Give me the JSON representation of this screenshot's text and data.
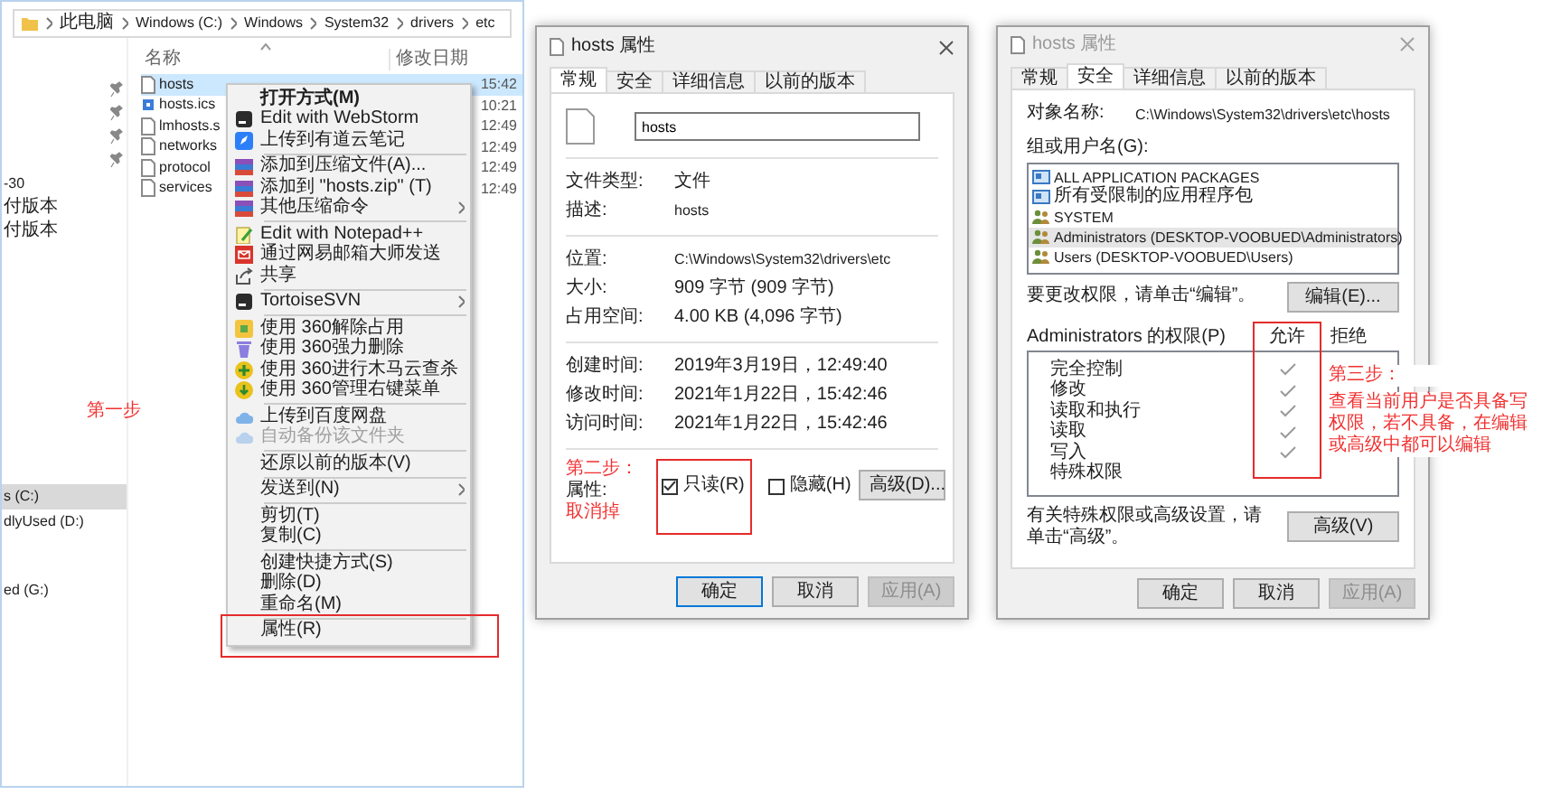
{
  "explorer": {
    "breadcrumb": [
      "此电脑",
      "Windows (C:)",
      "Windows",
      "System32",
      "drivers",
      "etc"
    ],
    "nav_items": [
      {
        "label": "-30",
        "selected": false
      },
      {
        "label": "付版本",
        "selected": false
      },
      {
        "label": "付版本",
        "selected": false
      },
      {
        "label": "s (C:)",
        "selected": true
      },
      {
        "label": "dlyUsed (D:)",
        "selected": false
      },
      {
        "label": "ed (G:)",
        "selected": false
      }
    ],
    "columns": [
      "名称",
      "修改日期"
    ],
    "files": [
      {
        "name": "hosts",
        "modified": "15:42",
        "kind": "document",
        "selected": true
      },
      {
        "name": "hosts.ics",
        "modified": "10:21",
        "kind": "settings",
        "selected": false
      },
      {
        "name": "lmhosts.s",
        "modified": "12:49",
        "kind": "document",
        "selected": false
      },
      {
        "name": "networks",
        "modified": "12:49",
        "kind": "document",
        "selected": false
      },
      {
        "name": "protocol",
        "modified": "12:49",
        "kind": "document",
        "selected": false
      },
      {
        "name": "services",
        "modified": "12:49",
        "kind": "document",
        "selected": false
      }
    ],
    "annotation": "第一步"
  },
  "context_menu": {
    "items": [
      {
        "kind": "item",
        "label": "打开方式(M)",
        "default": true,
        "disabled": false,
        "submenu": false,
        "highlighted": false
      },
      {
        "kind": "item",
        "label": "Edit with WebStorm",
        "default": false,
        "disabled": false,
        "submenu": false,
        "highlighted": false
      },
      {
        "kind": "item",
        "label": "上传到有道云笔记",
        "default": false,
        "disabled": false,
        "submenu": false,
        "highlighted": false
      },
      {
        "kind": "separator"
      },
      {
        "kind": "item",
        "label": "添加到压缩文件(A)...",
        "default": false,
        "disabled": false,
        "submenu": false,
        "highlighted": false
      },
      {
        "kind": "item",
        "label": "添加到 \"hosts.zip\" (T)",
        "default": false,
        "disabled": false,
        "submenu": false,
        "highlighted": false
      },
      {
        "kind": "item",
        "label": "其他压缩命令",
        "default": false,
        "disabled": false,
        "submenu": true,
        "highlighted": false
      },
      {
        "kind": "separator"
      },
      {
        "kind": "item",
        "label": "Edit with Notepad++",
        "default": false,
        "disabled": false,
        "submenu": false,
        "highlighted": false
      },
      {
        "kind": "item",
        "label": "通过网易邮箱大师发送",
        "default": false,
        "disabled": false,
        "submenu": false,
        "highlighted": false
      },
      {
        "kind": "item",
        "label": "共享",
        "default": false,
        "disabled": false,
        "submenu": false,
        "highlighted": false
      },
      {
        "kind": "separator"
      },
      {
        "kind": "item",
        "label": "TortoiseSVN",
        "default": false,
        "disabled": false,
        "submenu": true,
        "highlighted": false
      },
      {
        "kind": "separator"
      },
      {
        "kind": "item",
        "label": "使用 360解除占用",
        "default": false,
        "disabled": false,
        "submenu": false,
        "highlighted": false
      },
      {
        "kind": "item",
        "label": "使用 360强力删除",
        "default": false,
        "disabled": false,
        "submenu": false,
        "highlighted": false
      },
      {
        "kind": "item",
        "label": "使用 360进行木马云查杀",
        "default": false,
        "disabled": false,
        "submenu": false,
        "highlighted": false
      },
      {
        "kind": "item",
        "label": "使用 360管理右键菜单",
        "default": false,
        "disabled": false,
        "submenu": false,
        "highlighted": false
      },
      {
        "kind": "separator"
      },
      {
        "kind": "item",
        "label": "上传到百度网盘",
        "default": false,
        "disabled": false,
        "submenu": false,
        "highlighted": false
      },
      {
        "kind": "item",
        "label": "自动备份该文件夹",
        "default": false,
        "disabled": true,
        "submenu": false,
        "highlighted": false
      },
      {
        "kind": "separator"
      },
      {
        "kind": "item",
        "label": "还原以前的版本(V)",
        "default": false,
        "disabled": false,
        "submenu": false,
        "highlighted": false
      },
      {
        "kind": "separator"
      },
      {
        "kind": "item",
        "label": "发送到(N)",
        "default": false,
        "disabled": false,
        "submenu": true,
        "highlighted": false
      },
      {
        "kind": "separator"
      },
      {
        "kind": "item",
        "label": "剪切(T)",
        "default": false,
        "disabled": false,
        "submenu": false,
        "highlighted": false
      },
      {
        "kind": "item",
        "label": "复制(C)",
        "default": false,
        "disabled": false,
        "submenu": false,
        "highlighted": false
      },
      {
        "kind": "separator"
      },
      {
        "kind": "item",
        "label": "创建快捷方式(S)",
        "default": false,
        "disabled": false,
        "submenu": false,
        "highlighted": false
      },
      {
        "kind": "item",
        "label": "删除(D)",
        "default": false,
        "disabled": false,
        "submenu": false,
        "highlighted": false
      },
      {
        "kind": "item",
        "label": "重命名(M)",
        "default": false,
        "disabled": false,
        "submenu": false,
        "highlighted": false
      },
      {
        "kind": "separator"
      },
      {
        "kind": "item",
        "label": "属性(R)",
        "default": false,
        "disabled": false,
        "submenu": false,
        "highlighted": true
      }
    ]
  },
  "properties_dialog": {
    "title": "hosts 属性",
    "active": true,
    "tabs": [
      {
        "label": "常规",
        "selected": true
      },
      {
        "label": "安全",
        "selected": false
      },
      {
        "label": "详细信息",
        "selected": false
      },
      {
        "label": "以前的版本",
        "selected": false
      }
    ],
    "name_field": {
      "value": "hosts"
    },
    "sections": [
      [
        {
          "label": "文件类型:",
          "value": "文件"
        },
        {
          "label": "描述:",
          "value": "hosts"
        }
      ],
      [
        {
          "label": "位置:",
          "value": "C:\\Windows\\System32\\drivers\\etc"
        },
        {
          "label": "大小:",
          "value": "909 字节 (909 字节)"
        },
        {
          "label": "占用空间:",
          "value": "4.00 KB (4,096 字节)"
        }
      ],
      [
        {
          "label": "创建时间:",
          "value": "2019年3月19日，12:49:40"
        },
        {
          "label": "修改时间:",
          "value": "2021年1月22日，15:42:46"
        },
        {
          "label": "访问时间:",
          "value": "2021年1月22日，15:42:46"
        }
      ]
    ],
    "attributes": {
      "annotation_before": "第二步：",
      "label": "属性:",
      "annotation_after": "取消掉",
      "checkboxes": [
        {
          "label": "只读(R)",
          "checked": true,
          "highlighted": true
        },
        {
          "label": "隐藏(H)",
          "checked": false,
          "highlighted": false
        }
      ],
      "button": "高级(D)..."
    },
    "buttons": [
      {
        "label": "确定",
        "default": true,
        "disabled": false
      },
      {
        "label": "取消",
        "default": false,
        "disabled": false
      },
      {
        "label": "应用(A)",
        "default": false,
        "disabled": true
      }
    ]
  },
  "security_dialog": {
    "title": "hosts 属性",
    "active": false,
    "tabs": [
      {
        "label": "常规",
        "selected": false
      },
      {
        "label": "安全",
        "selected": true
      },
      {
        "label": "详细信息",
        "selected": false
      },
      {
        "label": "以前的版本",
        "selected": false
      }
    ],
    "object_label": "对象名称:",
    "object_value": "C:\\Windows\\System32\\drivers\\etc\\hosts",
    "groups_label": "组或用户名(G):",
    "groups": [
      {
        "name": "ALL APPLICATION PACKAGES",
        "kind": "package",
        "selected": false
      },
      {
        "name": "所有受限制的应用程序包",
        "kind": "package",
        "selected": false
      },
      {
        "name": "SYSTEM",
        "kind": "users",
        "selected": false
      },
      {
        "name": "Administrators (DESKTOP-VOOBUED\\Administrators)",
        "kind": "users",
        "selected": true
      },
      {
        "name": "Users (DESKTOP-VOOBUED\\Users)",
        "kind": "users",
        "selected": false
      }
    ],
    "edit_hint": "要更改权限，请单击“编辑”。",
    "edit_button": "编辑(E)...",
    "permissions_label": "Administrators 的权限(P)",
    "perm_columns": [
      {
        "label": "允许",
        "highlighted": true
      },
      {
        "label": "拒绝",
        "highlighted": false
      }
    ],
    "permissions": [
      {
        "name": "完全控制",
        "allow": true,
        "deny": false
      },
      {
        "name": "修改",
        "allow": true,
        "deny": false
      },
      {
        "name": "读取和执行",
        "allow": true,
        "deny": false
      },
      {
        "name": "读取",
        "allow": true,
        "deny": false
      },
      {
        "name": "写入",
        "allow": true,
        "deny": false
      },
      {
        "name": "特殊权限",
        "allow": false,
        "deny": false
      }
    ],
    "advanced_hint": "有关特殊权限或高级设置，请单击“高级”。",
    "advanced_button": "高级(V)",
    "buttons": [
      {
        "label": "确定",
        "default": false,
        "disabled": false
      },
      {
        "label": "取消",
        "default": false,
        "disabled": false
      },
      {
        "label": "应用(A)",
        "default": false,
        "disabled": true
      }
    ],
    "annotation": {
      "title": "第三步：",
      "text": "查看当前用户是否具备写权限，若不具备，在编辑或高级中都可以编辑"
    }
  }
}
